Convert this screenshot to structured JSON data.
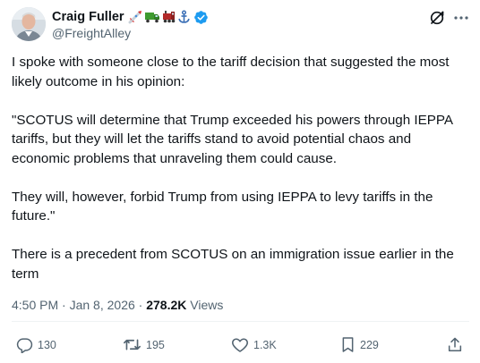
{
  "author": {
    "display_name": "Craig Fuller",
    "handle": "@FreightAlley",
    "badge_emojis": [
      "rocket-icon",
      "truck-icon",
      "train-icon",
      "anchor-icon"
    ],
    "verified": true
  },
  "tweet": {
    "paragraphs": [
      "I spoke with someone close to the tariff decision that suggested the most likely outcome in his opinion:",
      "\"SCOTUS will determine that Trump exceeded his powers through IEPPA tariffs, but they will let the tariffs stand to avoid potential chaos and economic problems that unraveling them could cause.",
      "They will, however, forbid Trump from using IEPPA to levy tariffs in the future.\"",
      "There is a precedent from SCOTUS on an immigration issue earlier in the term"
    ],
    "time": "4:50 PM",
    "separator": "·",
    "date": "Jan 8, 2026",
    "views_count": "278.2K",
    "views_label": "Views"
  },
  "actions": {
    "replies": "130",
    "reposts": "195",
    "likes": "1.3K",
    "bookmarks": "229"
  },
  "colors": {
    "text": "#0f1419",
    "secondary": "#536471",
    "verified": "#1d9bf0",
    "divider": "#eff3f4"
  }
}
